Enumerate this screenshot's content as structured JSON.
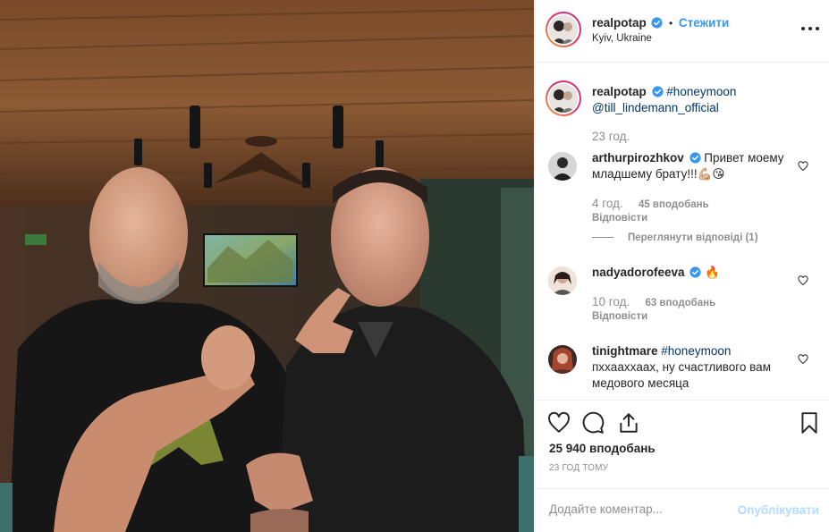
{
  "post": {
    "author": {
      "username": "realpotap",
      "verified": true,
      "follow_label": "Стежити",
      "separator": "•",
      "location": "Kyiv, Ukraine",
      "avatar_icon": "couple-avatar-icon"
    },
    "more_icon": "more-options-icon",
    "caption": {
      "username": "realpotap",
      "hashtag": "#honeymoon",
      "mention": "@till_lindemann_official",
      "time": "23 год."
    },
    "comments": [
      {
        "username": "arthurpirozhkov",
        "verified": true,
        "text": "Привет моему младшему брату!!!",
        "emoji": [
          "flexed-biceps-emoji",
          "wink-kiss-emoji"
        ],
        "time": "4 год.",
        "likes": "45 вподобань",
        "reply_label": "Відповісти",
        "view_replies_label": "Переглянути відповіді (1)"
      },
      {
        "username": "nadyadorofeeva",
        "verified": true,
        "text": "",
        "emoji": [
          "fire-emoji"
        ],
        "time": "10 год.",
        "likes": "63 вподобань",
        "reply_label": "Відповісти"
      },
      {
        "username": "tinightmare",
        "verified": false,
        "hashtag": "#honeymoon",
        "text": "пхxaaxxaax, ну счастливого вам медового месяца"
      }
    ],
    "actions": {
      "like_icon": "heart-icon",
      "comment_icon": "comment-bubble-icon",
      "share_icon": "share-icon",
      "save_icon": "bookmark-icon"
    },
    "likes_total": "25 940 вподобань",
    "posted_ago": "23 ГОД ТОМУ",
    "add_comment": {
      "placeholder": "Додайте коментар...",
      "publish_label": "Опублікувати"
    }
  },
  "colors": {
    "link": "#003569",
    "follow": "#3897f0",
    "muted": "#8e8e8e",
    "verified": "#3897f0",
    "publish_disabled": "#b3dbff"
  }
}
